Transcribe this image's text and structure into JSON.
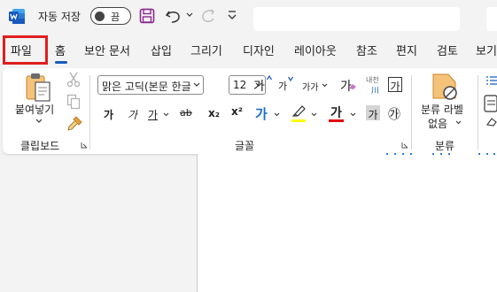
{
  "titlebar": {
    "autosave_label": "자동 저장",
    "autosave_state": "끔",
    "app_icon": "word-icon",
    "save_icon": "save-icon",
    "undo_icon": "undo-icon",
    "redo_icon": "redo-icon",
    "customize_icon": "customize-quick-access-icon"
  },
  "tabs": [
    {
      "label": "파일"
    },
    {
      "label": "홈"
    },
    {
      "label": "보안 문서"
    },
    {
      "label": "삽입"
    },
    {
      "label": "그리기"
    },
    {
      "label": "디자인"
    },
    {
      "label": "레이아웃"
    },
    {
      "label": "참조"
    },
    {
      "label": "편지"
    },
    {
      "label": "검토"
    },
    {
      "label": "보기"
    }
  ],
  "clipboard": {
    "paste_label": "붙여넣기",
    "group_label": "클립보드"
  },
  "font": {
    "font_name": "맑은 고딕(본문 한글",
    "font_size": "12",
    "grow_label": "가",
    "shrink_label": "가",
    "case_label": "가가",
    "clear_label": "가",
    "phonetic_label_top": "내천",
    "phonetic_label_bottom": "川",
    "border_label": "가",
    "bold_label": "가",
    "italic_label": "가",
    "underline_label": "가",
    "strike_label": "ab",
    "subscript_label": "x₂",
    "superscript_label": "x²",
    "effects_label": "가",
    "font_color_label": "가",
    "shading_label": "가",
    "enclosed_label": "㉮",
    "group_label": "글꼴",
    "highlight_color": "#ffff00",
    "font_color": "#e00000"
  },
  "classification": {
    "label_line1": "분류 라벨",
    "label_line2": "없음",
    "group_label": "분류"
  },
  "colors": {
    "accent": "#185abd",
    "file_highlight": "#e01e1e",
    "save_icon": "#8b2a8f"
  }
}
